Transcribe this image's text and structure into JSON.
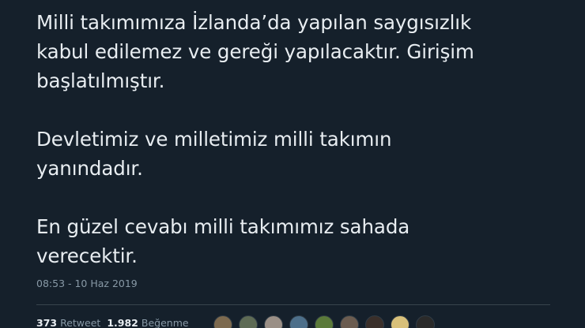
{
  "tweet": {
    "paragraphs": [
      {
        "lines": [
          "Milli takımımıza İzlanda’da yapılan saygısızlık",
          "kabul edilemez ve gereği yapılacaktır. Girişim",
          "başlatılmıştır."
        ]
      },
      {
        "lines": [
          "Devletimiz ve milletimiz milli takımın",
          "yanındadır."
        ]
      },
      {
        "lines": [
          "En güzel cevabı milli takımımız sahada",
          "verecektir."
        ]
      }
    ],
    "timestamp": "08:53 - 10 Haz 2019"
  },
  "stats": {
    "retweets_count": "373",
    "retweets_label": "Retweet",
    "likes_count": "1.982",
    "likes_label": "Beğenme"
  },
  "avatars": [
    {
      "color": "#7d6a4f"
    },
    {
      "color": "#5e6b55"
    },
    {
      "color": "#9a8f86"
    },
    {
      "color": "#4d6f8a"
    },
    {
      "color": "#5b7a3a"
    },
    {
      "color": "#6b5c50"
    },
    {
      "color": "#3a2f2a"
    },
    {
      "color": "#d8c07a"
    },
    {
      "color": "#2a2a2a"
    }
  ]
}
